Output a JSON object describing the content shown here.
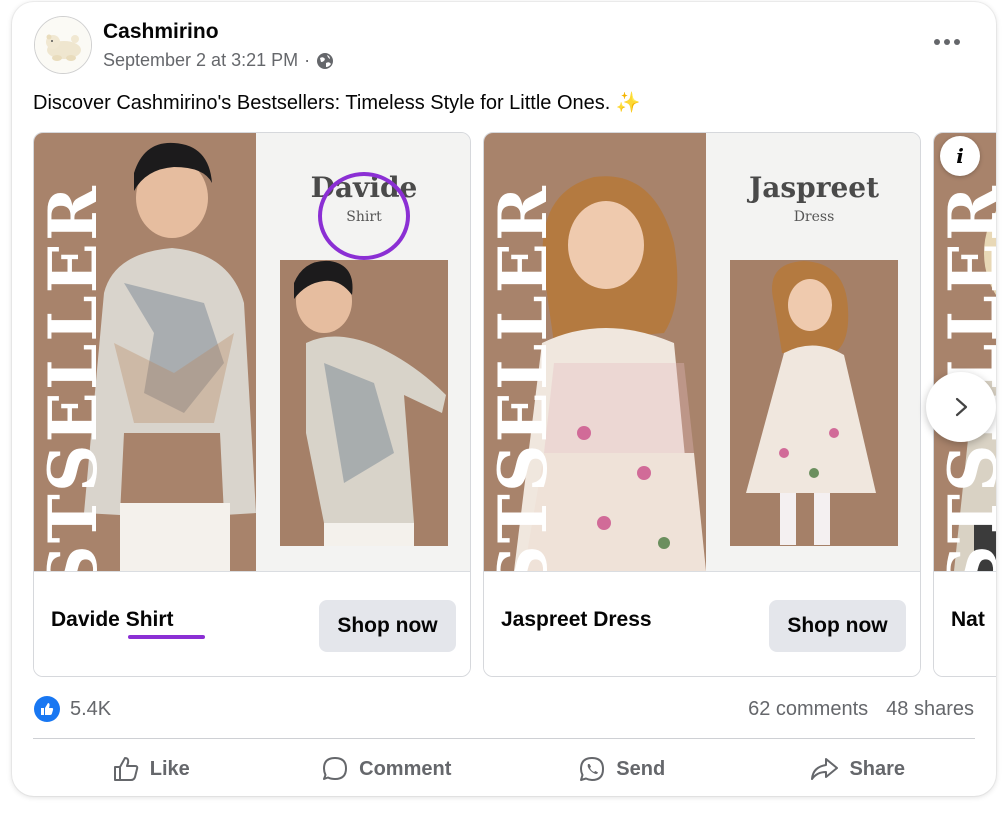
{
  "post": {
    "page_name": "Cashmirino",
    "timestamp": "September 2 at 3:21 PM",
    "separator": "·",
    "text": "Discover Cashmirino's Bestsellers: Timeless Style for Little Ones.",
    "sparkle": "✨"
  },
  "carousel": {
    "slides": [
      {
        "banner": "BESTSELLER",
        "panel_title": "Davide",
        "panel_subtitle": "Shirt",
        "product_name": "Davide Shirt",
        "cta": "Shop now"
      },
      {
        "banner": "BESTSELLER",
        "panel_title": "Jaspreet",
        "panel_subtitle": "Dress",
        "product_name": "Jaspreet Dress",
        "cta": "Shop now"
      },
      {
        "banner": "BESTSELLER",
        "product_name": "Nat"
      }
    ],
    "info_label": "i"
  },
  "stats": {
    "reactions": "5.4K",
    "comments": "62 comments",
    "shares": "48 shares"
  },
  "actions": {
    "like": "Like",
    "comment": "Comment",
    "send": "Send",
    "share": "Share"
  },
  "colors": {
    "accent": "#1877f2",
    "annotation": "#8b2fd4",
    "secondary_text": "#65676b",
    "photo_bg": "#a58068"
  }
}
